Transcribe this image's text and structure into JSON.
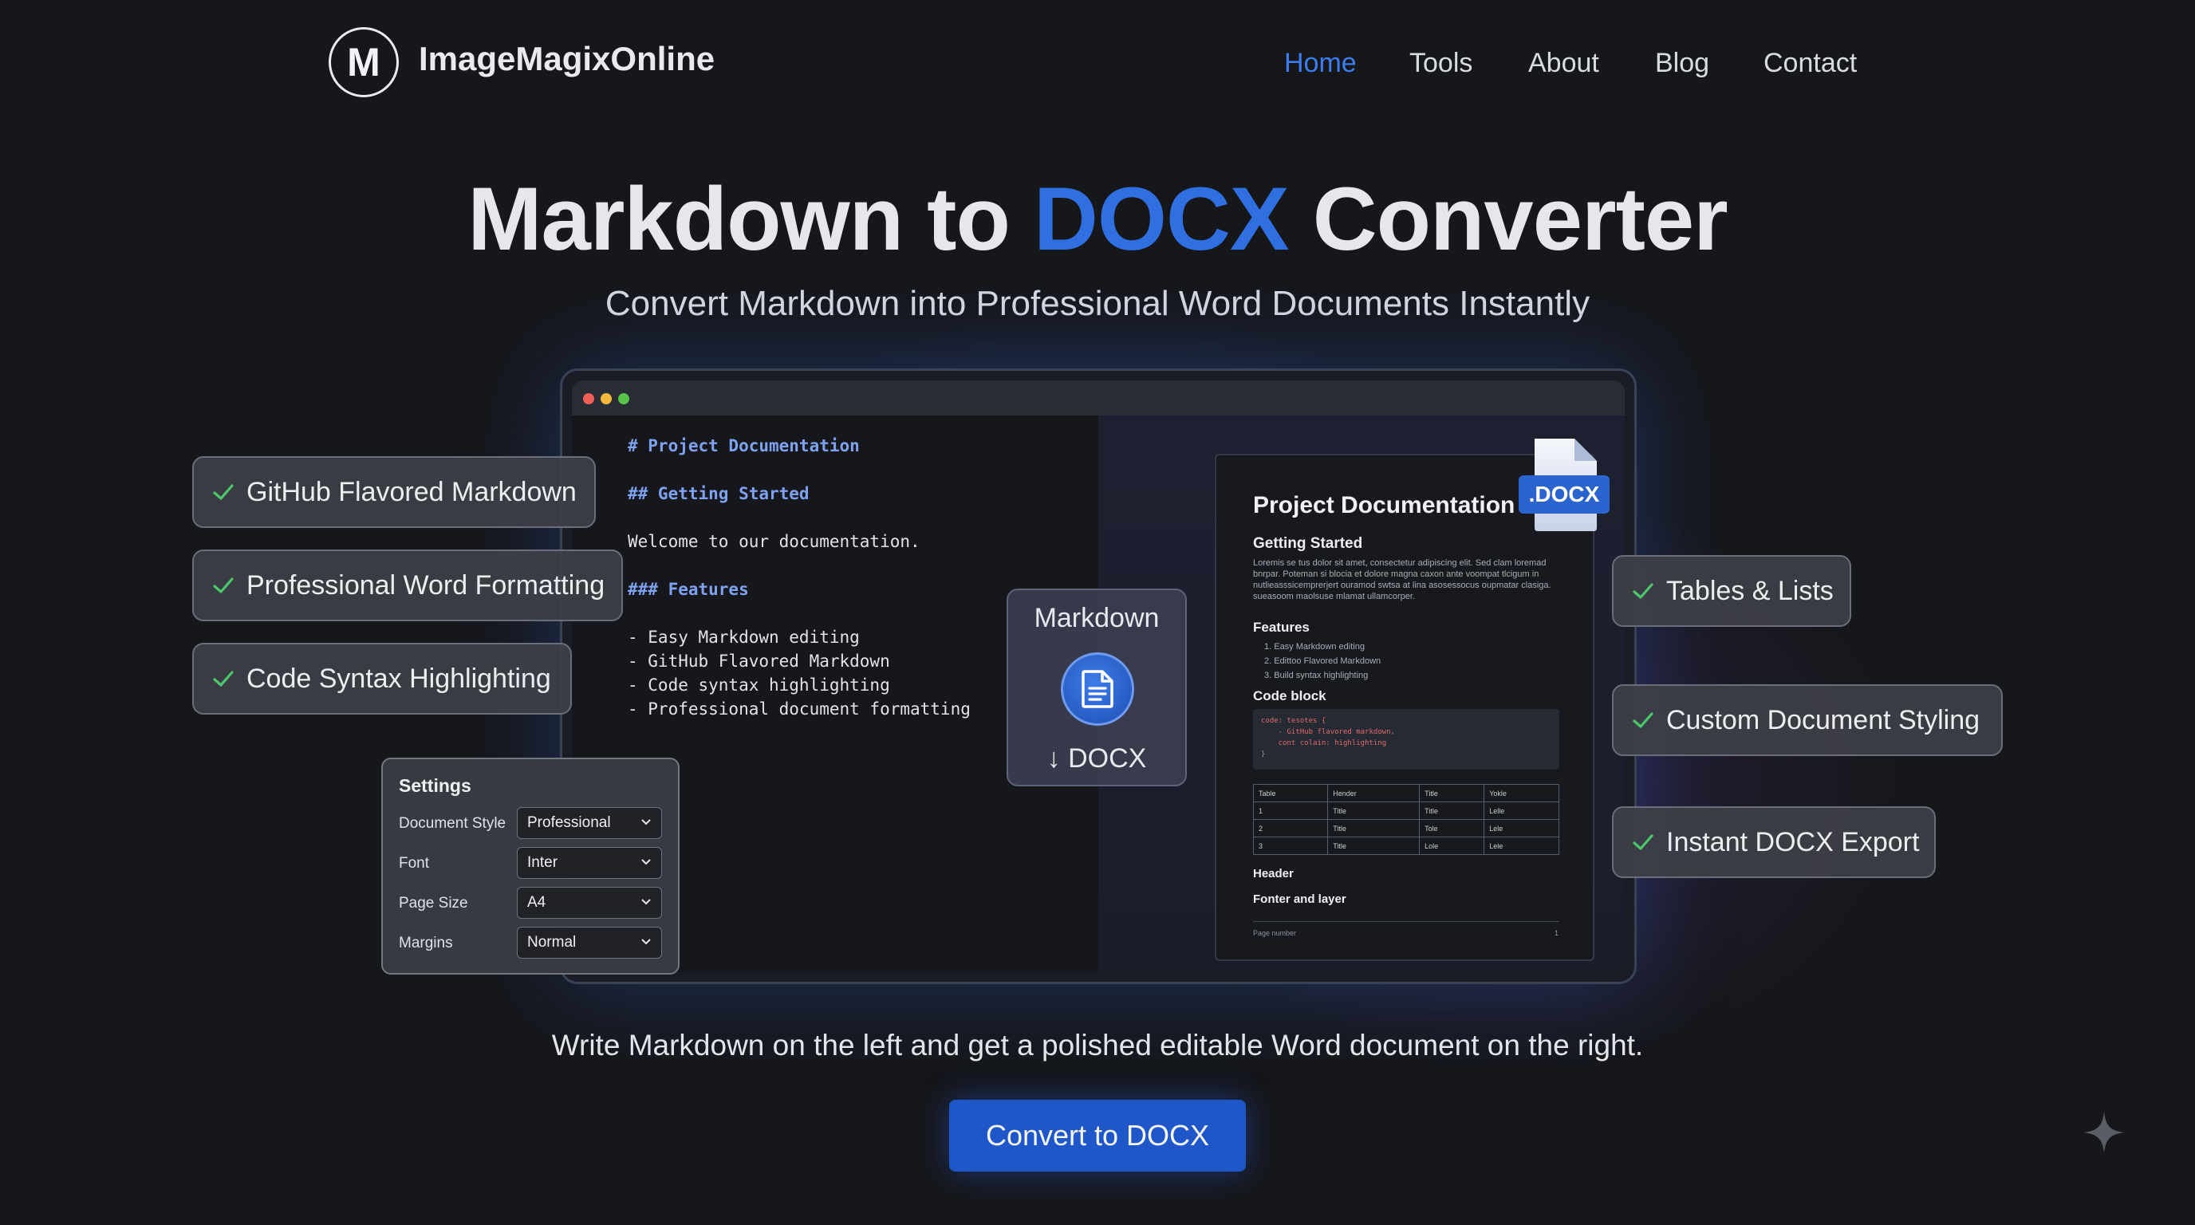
{
  "brand": {
    "logo_letter": "M",
    "name": "ImageMagixOnline"
  },
  "nav": [
    {
      "label": "Home",
      "active": true
    },
    {
      "label": "Tools"
    },
    {
      "label": "About"
    },
    {
      "label": "Blog"
    },
    {
      "label": "Contact"
    }
  ],
  "hero": {
    "title_pre": "Markdown to ",
    "title_accent": "DOCX",
    "title_post": " Converter",
    "subtitle": "Convert Markdown into Professional Word Documents Instantly"
  },
  "editor": {
    "lines": [
      "# Project Documentation",
      "## Getting Started",
      "Welcome to our documentation.",
      "### Features",
      "- Easy Markdown editing",
      "- GitHub Flavored Markdown",
      "- Code syntax highlighting",
      "- Professional document formatting"
    ]
  },
  "converter_card": {
    "from": "Markdown",
    "to": "↓ DOCX"
  },
  "docx_badge": ".DOCX",
  "document": {
    "title": "Project Documentation",
    "getting_started": "Getting Started",
    "lorem": "Loremis se tus dolor sit amet, consectetur adipiscing elit. Sed clam loremad bnrpar. Poteman si blocia et dolore magna caxon ante voompat tlcigum in nutlieasssicemprerjert ouramod swtsa at lina asosessocus oupmatar clasiga. sueasoom maolsuse mlamat ullamcorper.",
    "features_heading": "Features",
    "features": [
      "1.  Easy Markdown editing",
      "2.  Edittoo Flavored Markdown",
      "3.  Build syntax highlighting"
    ],
    "code_heading": "Code block",
    "code_lines": [
      "code: tesotes {",
      "    - GitHub flavored markdown,",
      "    cont colain: highlighting",
      "}"
    ],
    "table": [
      [
        "Table",
        "Hender",
        "Title",
        "Yokle"
      ],
      [
        "1",
        "Title",
        "Title",
        "Lelle"
      ],
      [
        "2",
        "Title",
        "Tole",
        "Lele"
      ],
      [
        "3",
        "Title",
        "Lole",
        "Lele"
      ]
    ],
    "header_label": "Header",
    "footer_label": "Fonter and layer",
    "page_label": "Page number",
    "page_number": "1"
  },
  "features_left": [
    "GitHub Flavored Markdown",
    "Professional Word Formatting",
    "Code Syntax Highlighting"
  ],
  "features_right": [
    "Tables & Lists",
    "Custom Document Styling",
    "Instant DOCX Export"
  ],
  "settings": {
    "title": "Settings",
    "rows": [
      {
        "label": "Document Style",
        "value": "Professional"
      },
      {
        "label": "Font",
        "value": "Inter"
      },
      {
        "label": "Page Size",
        "value": "A4"
      },
      {
        "label": "Margins",
        "value": "Normal"
      }
    ]
  },
  "tagline": "Write Markdown on the left and get a polished editable Word document on the right.",
  "cta": "Convert to DOCX",
  "colors": {
    "accent": "#2f6fe0",
    "nav_active": "#3d7df0",
    "check": "#4cc76b",
    "background": "#16171b"
  }
}
